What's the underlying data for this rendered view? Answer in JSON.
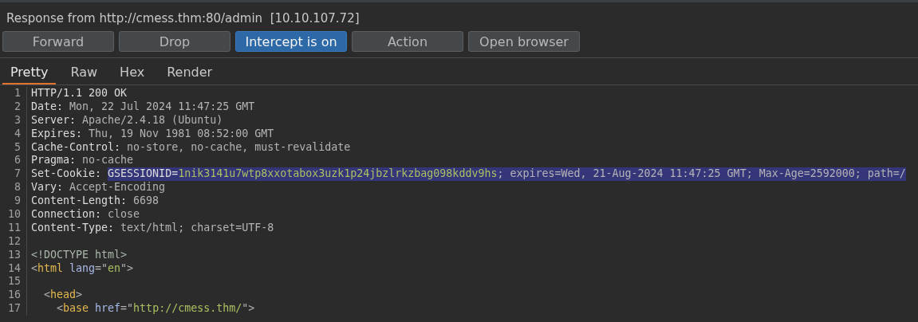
{
  "title": "Response from http://cmess.thm:80/admin  [10.10.107.72]",
  "buttons": [
    {
      "label": "Forward",
      "selected": false
    },
    {
      "label": "Drop",
      "selected": false
    },
    {
      "label": "Intercept is on",
      "selected": true
    },
    {
      "label": "Action",
      "selected": false
    },
    {
      "label": "Open browser",
      "selected": false
    }
  ],
  "tabs": [
    {
      "label": "Pretty",
      "selected": true
    },
    {
      "label": "Raw",
      "selected": false
    },
    {
      "label": "Hex",
      "selected": false
    },
    {
      "label": "Render",
      "selected": false
    }
  ],
  "lines": [
    {
      "number": "1",
      "segments": [
        {
          "kind": "name",
          "text": "HTTP/1.1 200 OK",
          "selected": false
        }
      ]
    },
    {
      "number": "2",
      "segments": [
        {
          "kind": "name",
          "text": "Date: ",
          "selected": false
        },
        {
          "kind": "value",
          "text": "Mon, 22 Jul 2024 11:47:25 GMT",
          "selected": false
        }
      ]
    },
    {
      "number": "3",
      "segments": [
        {
          "kind": "name",
          "text": "Server: ",
          "selected": false
        },
        {
          "kind": "value",
          "text": "Apache/2.4.18 (Ubuntu)",
          "selected": false
        }
      ]
    },
    {
      "number": "4",
      "segments": [
        {
          "kind": "name",
          "text": "Expires: ",
          "selected": false
        },
        {
          "kind": "value",
          "text": "Thu, 19 Nov 1981 08:52:00 GMT",
          "selected": false
        }
      ]
    },
    {
      "number": "5",
      "segments": [
        {
          "kind": "name",
          "text": "Cache-Control: ",
          "selected": false
        },
        {
          "kind": "value",
          "text": "no-store, no-cache, must-revalidate",
          "selected": false
        }
      ]
    },
    {
      "number": "6",
      "segments": [
        {
          "kind": "name",
          "text": "Pragma: ",
          "selected": false
        },
        {
          "kind": "value",
          "text": "no-cache",
          "selected": false
        }
      ]
    },
    {
      "number": "7",
      "segments": [
        {
          "kind": "name",
          "text": "Set-Cookie: ",
          "selected": false
        },
        {
          "kind": "name",
          "text": "GSESSIONID=",
          "selected": true
        },
        {
          "kind": "string",
          "text": "1nik3141u7wtp8xxotabox3uzk1p24jbzlrkzbag098kddv9hs",
          "selected": true
        },
        {
          "kind": "value",
          "text": "; expires=Wed, 21-Aug-2024 11:47:25 GMT; Max-Age=2592000; path=/",
          "selected": true
        }
      ]
    },
    {
      "number": "8",
      "segments": [
        {
          "kind": "name",
          "text": "Vary: ",
          "selected": false
        },
        {
          "kind": "value",
          "text": "Accept-Encoding",
          "selected": false
        }
      ]
    },
    {
      "number": "9",
      "segments": [
        {
          "kind": "name",
          "text": "Content-Length: ",
          "selected": false
        },
        {
          "kind": "value",
          "text": "6698",
          "selected": false
        }
      ]
    },
    {
      "number": "10",
      "segments": [
        {
          "kind": "name",
          "text": "Connection: ",
          "selected": false
        },
        {
          "kind": "value",
          "text": "close",
          "selected": false
        }
      ]
    },
    {
      "number": "11",
      "segments": [
        {
          "kind": "name",
          "text": "Content-Type: ",
          "selected": false
        },
        {
          "kind": "value",
          "text": "text/html; charset=UTF-8",
          "selected": false
        }
      ]
    },
    {
      "number": "12"
    },
    {
      "number": "13",
      "segments": [
        {
          "kind": "doctype",
          "text": "<!DOCTYPE html>",
          "selected": false
        }
      ]
    },
    {
      "number": "14",
      "segments": [
        {
          "kind": "punct",
          "text": "<",
          "selected": false
        },
        {
          "kind": "tag",
          "text": "html",
          "selected": false
        },
        {
          "kind": "attr",
          "text": " lang",
          "selected": false
        },
        {
          "kind": "punct",
          "text": "=\"",
          "selected": false
        },
        {
          "kind": "string",
          "text": "en",
          "selected": false
        },
        {
          "kind": "punct",
          "text": "\">",
          "selected": false
        }
      ]
    },
    {
      "number": "15"
    },
    {
      "number": "16",
      "segments": [
        {
          "kind": "punct",
          "text": "  <",
          "selected": false
        },
        {
          "kind": "tag",
          "text": "head",
          "selected": false
        },
        {
          "kind": "punct",
          "text": ">",
          "selected": false
        }
      ]
    },
    {
      "number": "17",
      "segments": [
        {
          "kind": "punct",
          "text": "    <",
          "selected": false
        },
        {
          "kind": "tag",
          "text": "base",
          "selected": false
        },
        {
          "kind": "attr",
          "text": " href",
          "selected": false
        },
        {
          "kind": "punct",
          "text": "=\"",
          "selected": false
        },
        {
          "kind": "string",
          "text": "http://cmess.thm/",
          "selected": false
        },
        {
          "kind": "punct",
          "text": "\">",
          "selected": false
        }
      ]
    }
  ]
}
